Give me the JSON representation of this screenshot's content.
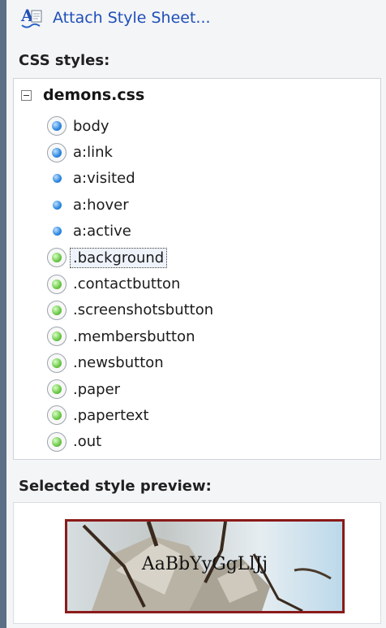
{
  "toolbar": {
    "attach_label": "Attach Style Sheet...",
    "attach_icon_letter": "A"
  },
  "css_styles": {
    "heading": "CSS styles:",
    "root": "demons.css",
    "items": [
      {
        "label": "body",
        "bullet": "blue-ringed"
      },
      {
        "label": "a:link",
        "bullet": "blue-ringed"
      },
      {
        "label": "a:visited",
        "bullet": "blue"
      },
      {
        "label": "a:hover",
        "bullet": "blue"
      },
      {
        "label": "a:active",
        "bullet": "blue"
      },
      {
        "label": ".background",
        "bullet": "green-ringed",
        "selected": true
      },
      {
        "label": ".contactbutton",
        "bullet": "green-ringed"
      },
      {
        "label": ".screenshotsbutton",
        "bullet": "green-ringed"
      },
      {
        "label": ".membersbutton",
        "bullet": "green-ringed"
      },
      {
        "label": ".newsbutton",
        "bullet": "green-ringed"
      },
      {
        "label": ".paper",
        "bullet": "green-ringed"
      },
      {
        "label": ".papertext",
        "bullet": "green-ringed"
      },
      {
        "label": ".out",
        "bullet": "green-ringed"
      }
    ]
  },
  "preview": {
    "heading": "Selected style preview:",
    "sample_text": "AaBbYyGgLlJj"
  },
  "colors": {
    "link_blue": "#1f4fb8",
    "preview_border": "#8b1a1a",
    "panel_bg": "#f4f5f7"
  }
}
